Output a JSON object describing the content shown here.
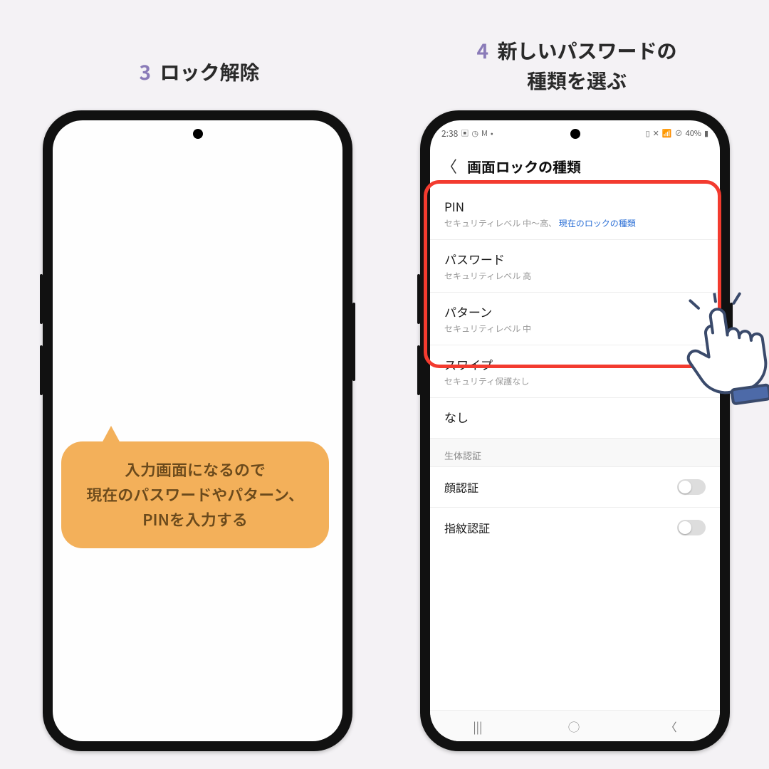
{
  "steps": {
    "left": {
      "num": "3",
      "text": "ロック解除"
    },
    "right": {
      "num": "4",
      "text": "新しいパスワードの\n種類を選ぶ"
    }
  },
  "bubble": "入力画面になるので\n現在のパスワードやパターン、\nPINを入力する",
  "statusbar": {
    "time": "2:38",
    "battery": "40%"
  },
  "header": {
    "title": "画面ロックの種類"
  },
  "items": {
    "pin": {
      "title": "PIN",
      "sub": "セキュリティレベル 中〜高、",
      "extra": "現在のロックの種類"
    },
    "password": {
      "title": "パスワード",
      "sub": "セキュリティレベル 高"
    },
    "pattern": {
      "title": "パターン",
      "sub": "セキュリティレベル 中"
    },
    "swipe": {
      "title": "スワイプ",
      "sub": "セキュリティ保護なし"
    },
    "none": {
      "title": "なし"
    }
  },
  "section": {
    "biometrics": "生体認証"
  },
  "toggles": {
    "face": {
      "label": "顔認証"
    },
    "finger": {
      "label": "指紋認証"
    }
  }
}
